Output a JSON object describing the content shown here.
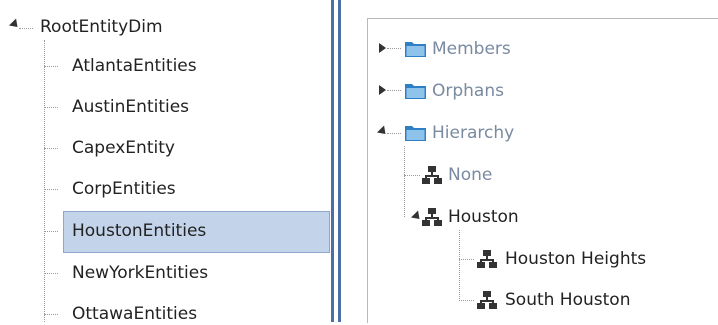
{
  "left_tree": {
    "root": {
      "label": "RootEntityDim",
      "expanded": true
    },
    "items": [
      {
        "label": "AtlantaEntities",
        "selected": false
      },
      {
        "label": "AustinEntities",
        "selected": false
      },
      {
        "label": "CapexEntity",
        "selected": false
      },
      {
        "label": "CorpEntities",
        "selected": false
      },
      {
        "label": "HoustonEntities",
        "selected": true
      },
      {
        "label": "NewYorkEntities",
        "selected": false
      },
      {
        "label": "OttawaEntities",
        "selected": false
      }
    ]
  },
  "right_tree": {
    "members": {
      "label": "Members",
      "expanded": false,
      "icon": "folder-icon"
    },
    "orphans": {
      "label": "Orphans",
      "expanded": false,
      "icon": "folder-icon"
    },
    "hierarchy": {
      "label": "Hierarchy",
      "expanded": true,
      "icon": "folder-icon",
      "children": [
        {
          "label": "None",
          "icon": "hierarchy-icon"
        },
        {
          "label": "Houston",
          "icon": "hierarchy-icon",
          "expanded": true,
          "children": [
            {
              "label": "Houston Heights",
              "icon": "hierarchy-icon"
            },
            {
              "label": "South Houston",
              "icon": "hierarchy-icon"
            }
          ]
        }
      ]
    }
  },
  "colors": {
    "selection": "#c3d3ea",
    "splitter": "#4e6ea6",
    "folder": "#2f7fc4",
    "muted_text": "#7a8aa0"
  }
}
